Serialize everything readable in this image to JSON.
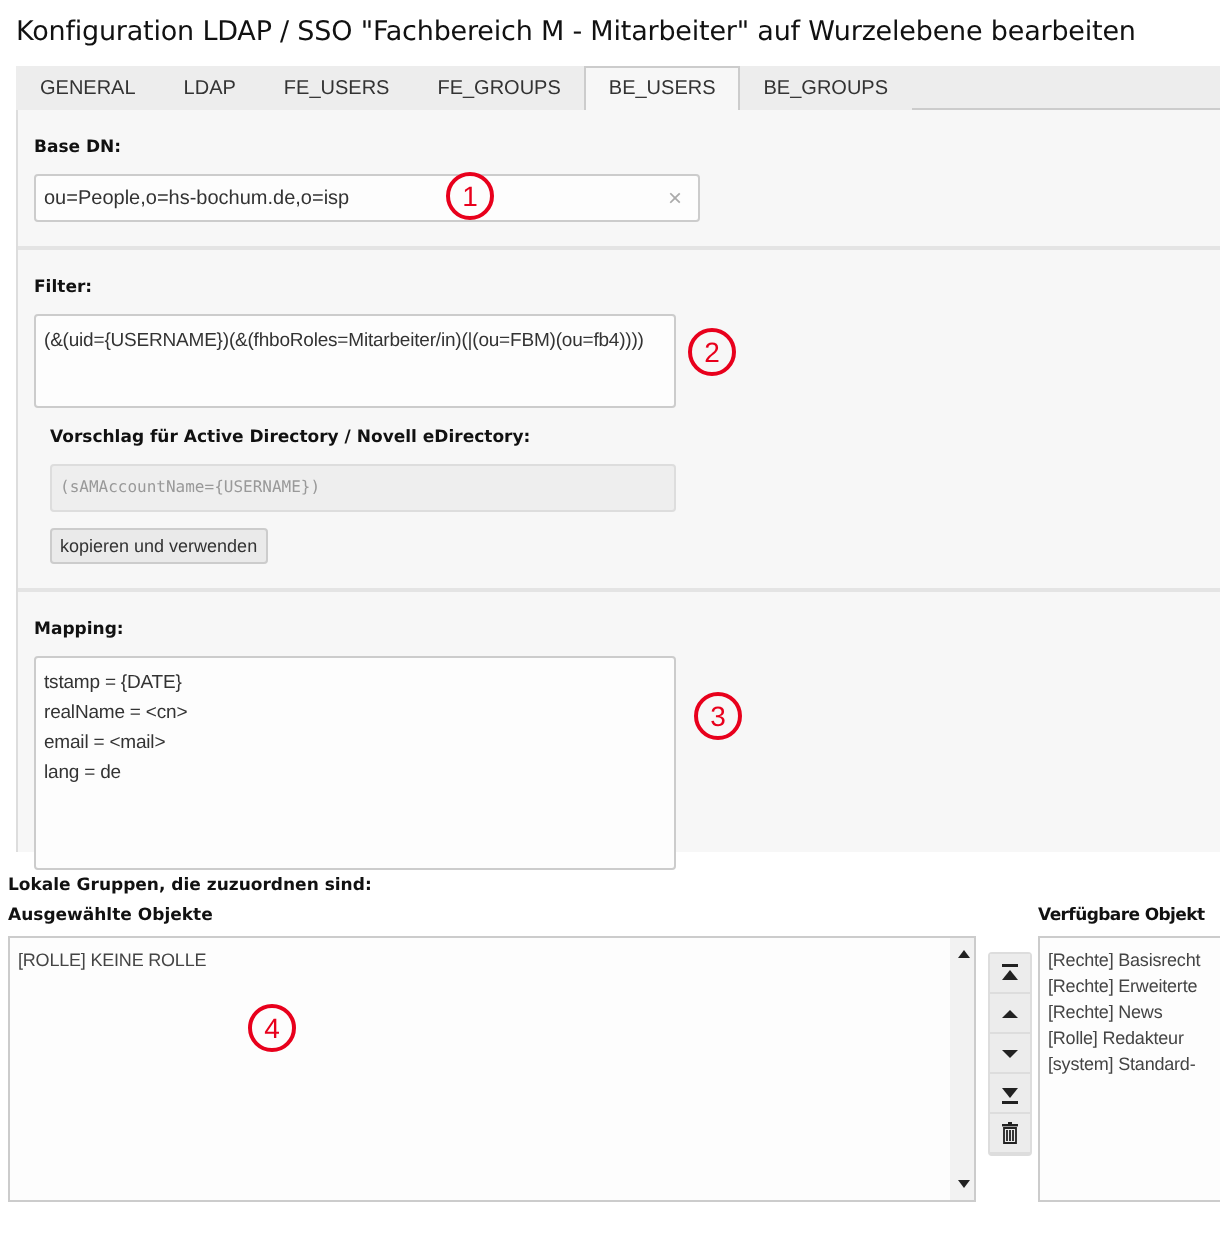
{
  "title": "Konfiguration LDAP / SSO \"Fachbereich M - Mitarbeiter\" auf Wurzelebene bearbeiten",
  "tabs": [
    {
      "label": "GENERAL",
      "selected": false
    },
    {
      "label": "LDAP",
      "selected": false
    },
    {
      "label": "FE_USERS",
      "selected": false
    },
    {
      "label": "FE_GROUPS",
      "selected": false
    },
    {
      "label": "BE_USERS",
      "selected": true
    },
    {
      "label": "BE_GROUPS",
      "selected": false
    }
  ],
  "base_dn": {
    "label": "Base DN:",
    "value": "ou=People,o=hs-bochum.de,o=isp",
    "clear": "×",
    "annotation": "1"
  },
  "filter": {
    "label": "Filter:",
    "value": "(&(uid={USERNAME})(&(fhboRoles=Mitarbeiter/in)(|(ou=FBM)(ou=fb4))))",
    "annotation": "2",
    "suggestion": {
      "label": "Vorschlag für Active Directory / Novell eDirectory:",
      "placeholder": "(sAMAccountName={USERNAME})",
      "button": "kopieren und verwenden"
    }
  },
  "mapping": {
    "label": "Mapping:",
    "value": "tstamp = {DATE}\nrealName = <cn>\nemail = <mail>\nlang = de",
    "annotation": "3"
  },
  "groups": {
    "label": "Lokale Gruppen, die zuzuordnen sind:",
    "annotation": "4",
    "selected": {
      "label": "Ausgewählte Objekte",
      "items": [
        "[ROLLE] KEINE ROLLE"
      ]
    },
    "available": {
      "label": "Verfügbare Objekt",
      "items": [
        "[Rechte] Basisrecht",
        "[Rechte] Erweiterte",
        "[Rechte] News",
        "[Rolle] Redakteur",
        "[system] Standard-"
      ]
    }
  }
}
